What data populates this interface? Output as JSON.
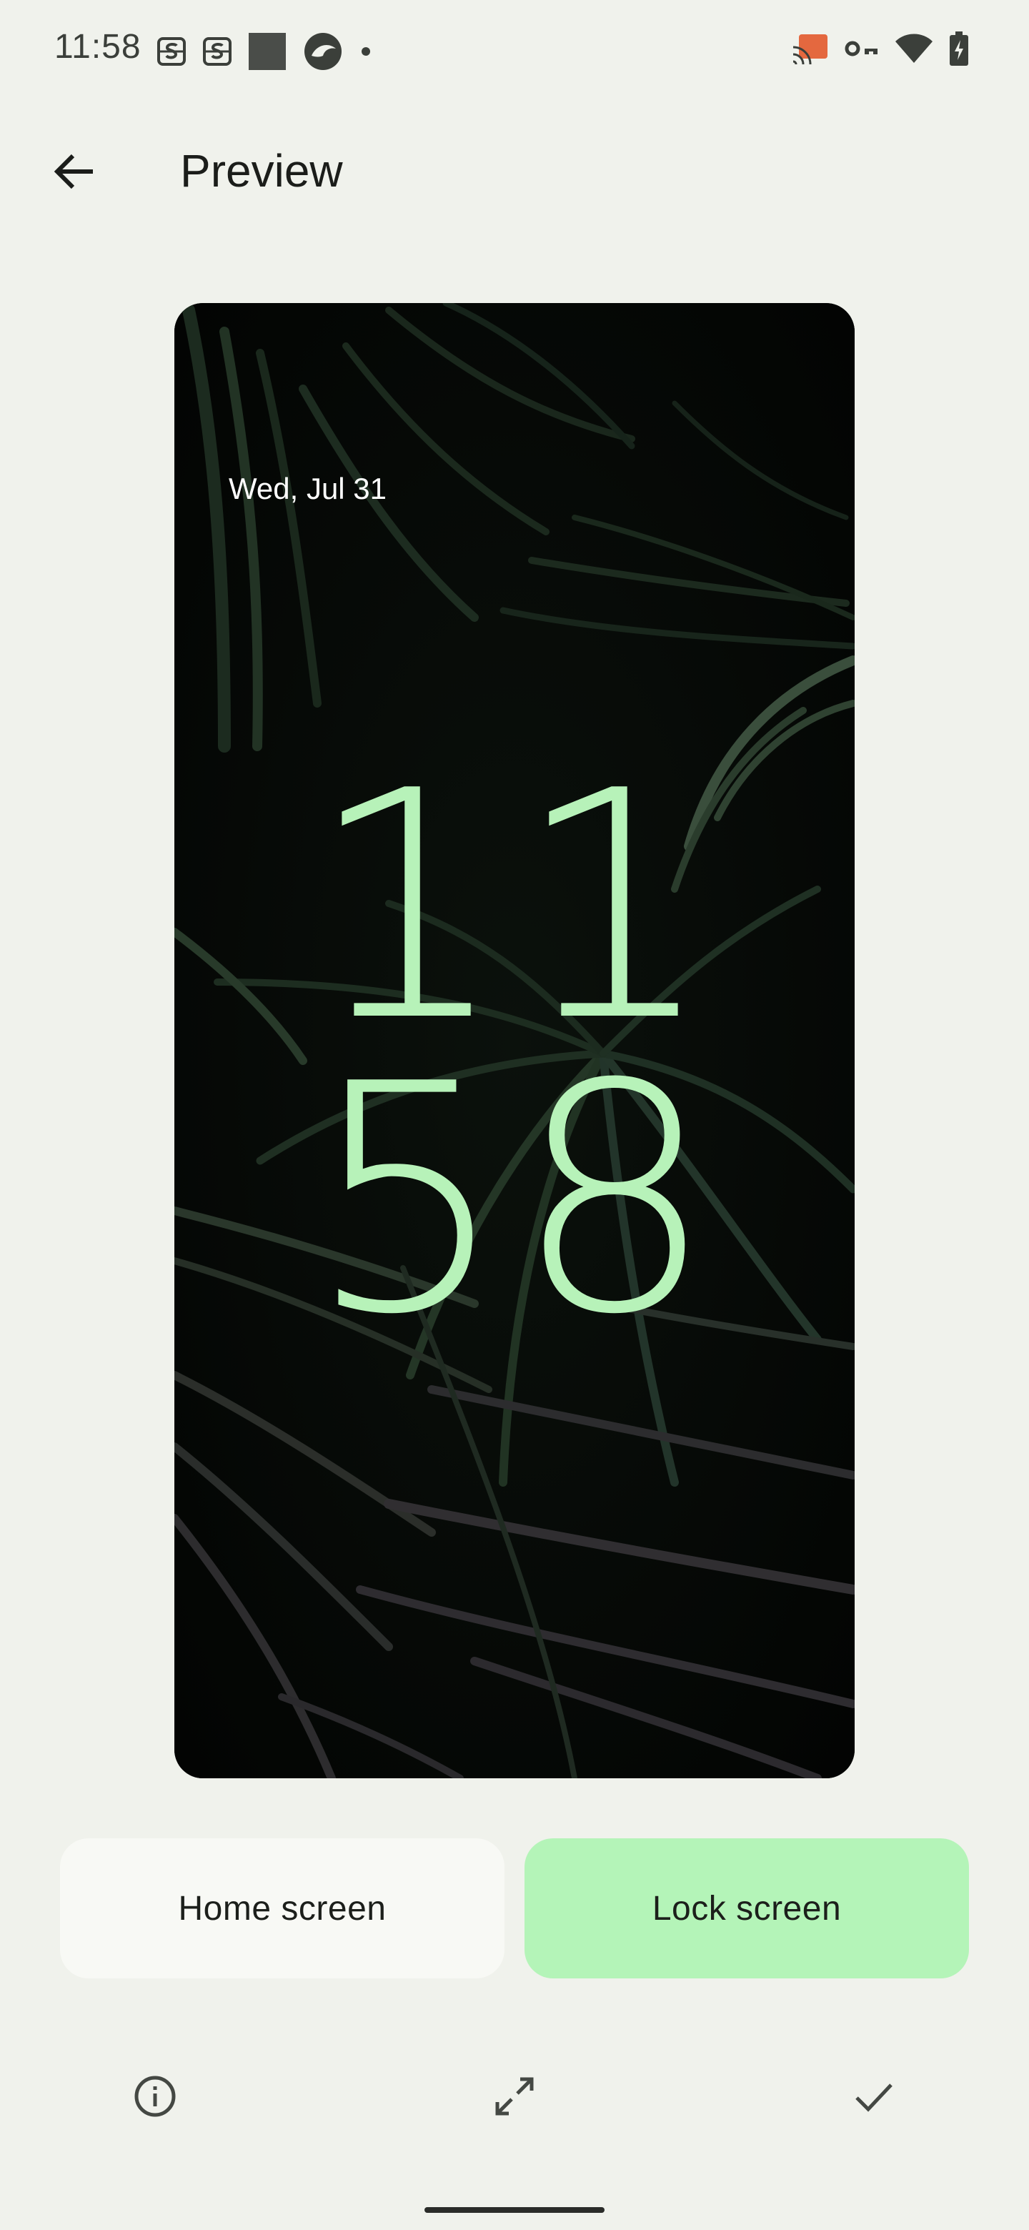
{
  "status_bar": {
    "time": "11:58",
    "left_icons": [
      "sim-s-icon",
      "sim-s-icon",
      "square-app-icon",
      "circle-app-icon",
      "dot-icon"
    ],
    "right_icons": [
      "cast-icon",
      "vpn-key-icon",
      "wifi-icon",
      "battery-charging-icon"
    ],
    "cast_color": "#e4683f"
  },
  "app_bar": {
    "back_icon": "arrow-back-icon",
    "title": "Preview"
  },
  "preview": {
    "date": "Wed, Jul 31",
    "clock_hours": "11",
    "clock_minutes": "58",
    "clock_color": "#b7f2b9",
    "wallpaper": "dark palm leaves"
  },
  "toggle": {
    "home_label": "Home screen",
    "lock_label": "Lock screen",
    "selected": "lock",
    "selected_color": "#b4f4b8"
  },
  "actions": {
    "info_icon": "info-icon",
    "expand_icon": "expand-icon",
    "apply_icon": "check-icon"
  }
}
